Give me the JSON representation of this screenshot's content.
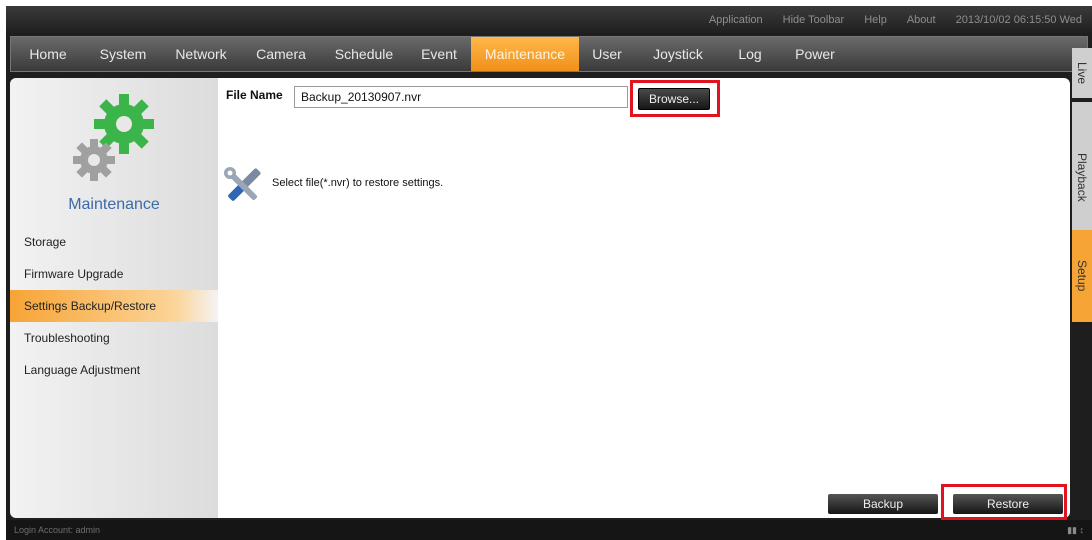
{
  "toolbar": {
    "links": [
      "Application",
      "Hide Toolbar",
      "Help",
      "About"
    ],
    "datetime": "2013/10/02 06:15:50 Wed"
  },
  "nav": {
    "items": [
      "Home",
      "System",
      "Network",
      "Camera",
      "Schedule",
      "Event",
      "Maintenance",
      "User",
      "Joystick",
      "Log",
      "Power"
    ],
    "active": "Maintenance"
  },
  "sidebar": {
    "title": "Maintenance",
    "items": [
      "Storage",
      "Firmware Upgrade",
      "Settings Backup/Restore",
      "Troubleshooting",
      "Language Adjustment"
    ],
    "active": "Settings Backup/Restore"
  },
  "content": {
    "file_label": "File Name",
    "file_value": "Backup_20130907.nvr",
    "browse_label": "Browse...",
    "hint": "Select file(*.nvr) to restore settings.",
    "backup_label": "Backup",
    "restore_label": "Restore"
  },
  "side_tabs": {
    "items": [
      "Live",
      "Playback",
      "Setup"
    ],
    "active": "Setup"
  },
  "status": {
    "login": "Login Account: admin"
  },
  "colors": {
    "accent": "#f7a436",
    "highlight": "#e0141e",
    "title_blue": "#3c6aa8"
  }
}
